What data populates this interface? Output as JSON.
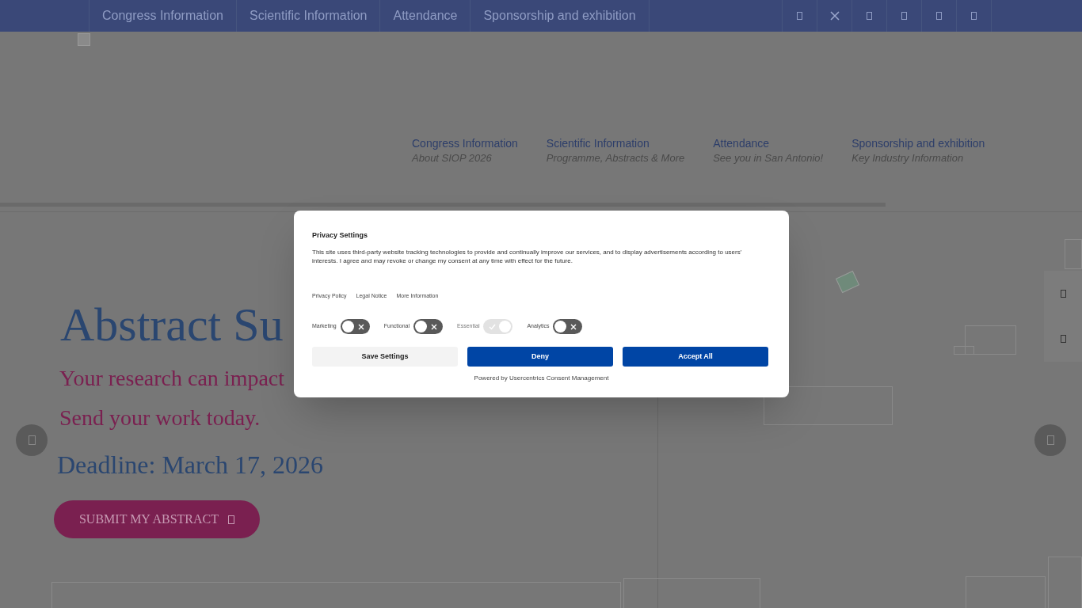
{
  "top_nav": {
    "items": [
      "Congress Information",
      "Scientific Information",
      "Attendance",
      "Sponsorship and exhibition"
    ]
  },
  "main_nav": [
    {
      "label": "Congress Information",
      "subtitle": "About SIOP 2026"
    },
    {
      "label": "Scientific Information",
      "subtitle": "Programme, Abstracts & More"
    },
    {
      "label": "Attendance",
      "subtitle": "See you in San Antonio!"
    },
    {
      "label": "Sponsorship and exhibition",
      "subtitle": "Key Industry Information"
    }
  ],
  "hero": {
    "heading": "Abstract Su",
    "line_1": "Your research can impact",
    "line_2": "Send your work today.",
    "deadline": "Deadline: March 17, 2026",
    "button": "SUBMIT MY ABSTRACT"
  },
  "consent": {
    "title": "Privacy Settings",
    "text": "This site uses third-party website tracking technologies to provide and continually improve our services, and to display advertisements according to users' interests. I agree and may revoke or change my consent at any time with effect for the future.",
    "links": [
      "Privacy Policy",
      "Legal Notice",
      "More Information"
    ],
    "toggles": [
      {
        "label": "Marketing",
        "on": false,
        "disabled": false
      },
      {
        "label": "Functional",
        "on": false,
        "disabled": false
      },
      {
        "label": "Essential",
        "on": true,
        "disabled": true
      },
      {
        "label": "Analytics",
        "on": false,
        "disabled": false
      }
    ],
    "buttons": [
      {
        "label": "Save Settings",
        "kind": "secondary"
      },
      {
        "label": "Deny",
        "kind": "primary"
      },
      {
        "label": "Accept All",
        "kind": "primary"
      }
    ],
    "footer": "Powered by Usercentrics Consent Management"
  }
}
